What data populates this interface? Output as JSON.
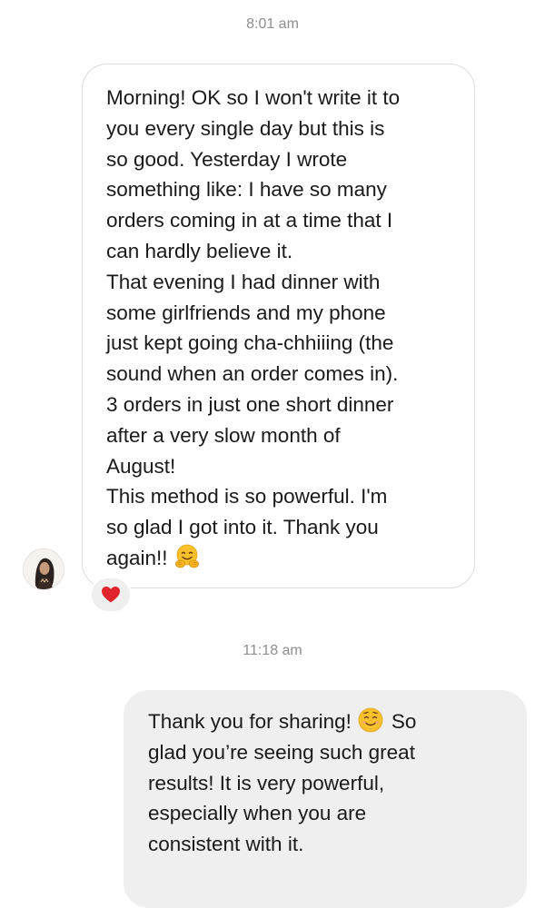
{
  "conversation": {
    "timestamps": [
      "8:01 am",
      "11:18 am"
    ],
    "incoming_message": {
      "lines": [
        "Morning! OK so I won't write it to",
        "you every single day but this is",
        "so good. Yesterday I wrote",
        "something like: I have so many",
        "orders coming in at a time that I",
        "can hardly believe it.",
        "That evening I had dinner with",
        "some girlfriends and my phone",
        "just kept going cha-chhiiing (the",
        "sound when an order comes in).",
        "3 orders in just one short dinner",
        "after a very slow month of",
        "August!",
        "This method is so powerful. I'm",
        "so glad I got into it. Thank you",
        "again!!"
      ],
      "emoji": "hugging-face-icon",
      "reaction": "red-heart-icon"
    },
    "outgoing_message": {
      "lines": [
        "Thank you for sharing!",
        "glad you’re seeing such great",
        "results! It is very powerful,",
        "especially when you are",
        "consistent with it."
      ],
      "line1_after_emoji": "So",
      "emoji": "smiling-face-icon"
    }
  },
  "colors": {
    "timestamp": "#8e8e8e",
    "incoming_border": "#dcdcdc",
    "outgoing_bg": "#efefef",
    "heart": "#e0242c",
    "emoji_yellow": "#f8c12c"
  }
}
